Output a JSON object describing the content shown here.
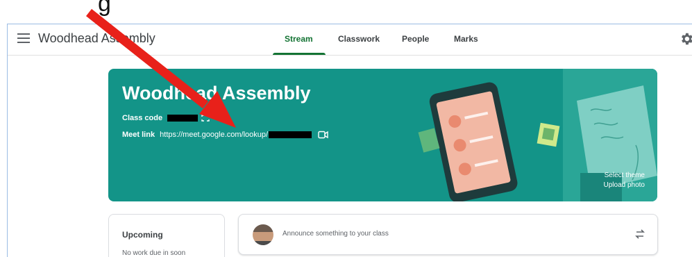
{
  "caption": {
    "visible_fragment": "g"
  },
  "topbar": {
    "title": "Woodhead Assembly",
    "tabs": [
      {
        "label": "Stream",
        "active": true
      },
      {
        "label": "Classwork",
        "active": false
      },
      {
        "label": "People",
        "active": false
      },
      {
        "label": "Marks",
        "active": false
      }
    ]
  },
  "banner": {
    "title": "Woodhead Assembly",
    "class_code_label": "Class code",
    "meet_label": "Meet link",
    "meet_url": "https://meet.google.com/lookup/",
    "select_theme": "Select theme",
    "upload_photo": "Upload photo",
    "color": "#139488"
  },
  "upcoming": {
    "title": "Upcoming",
    "body": "No work due in soon"
  },
  "announce": {
    "placeholder": "Announce something to your class"
  },
  "annotation": {
    "arrow_color": "#e8211a"
  },
  "icons": [
    "menu-icon",
    "gear-icon",
    "fullscreen-icon",
    "video-icon",
    "repost-icon",
    "avatar"
  ]
}
